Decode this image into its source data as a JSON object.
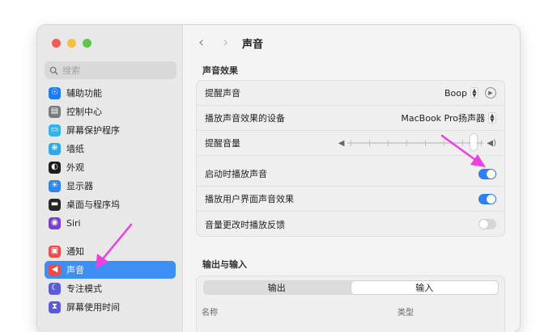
{
  "window": {
    "title": "声音",
    "traffic_lights": {
      "close": "#ee5e57",
      "minimize": "#f5bf41",
      "zoom": "#5ec64d"
    }
  },
  "sidebar": {
    "search": {
      "placeholder": "搜索"
    },
    "items": [
      {
        "label": "辅助功能",
        "icon": "accessibility-icon",
        "color": "#1d7bf0",
        "glyph": "☉"
      },
      {
        "label": "控制中心",
        "icon": "control-center-icon",
        "color": "#7a7a7a",
        "glyph": "▤"
      },
      {
        "label": "屏幕保护程序",
        "icon": "screensaver-icon",
        "color": "#36b3e8",
        "glyph": "▭"
      },
      {
        "label": "墙纸",
        "icon": "wallpaper-icon",
        "color": "#31a7e8",
        "glyph": "❋"
      },
      {
        "label": "外观",
        "icon": "appearance-icon",
        "color": "#1c1c1c",
        "glyph": "◐"
      },
      {
        "label": "显示器",
        "icon": "display-icon",
        "color": "#2f86ee",
        "glyph": "☀"
      },
      {
        "label": "桌面与程序坞",
        "icon": "dock-icon",
        "color": "#262626",
        "glyph": "▬"
      },
      {
        "label": "Siri",
        "icon": "siri-icon",
        "color": "#7b3fd0",
        "glyph": "◉"
      },
      {
        "label": "通知",
        "icon": "notifications-icon",
        "color": "#ec4b4b",
        "glyph": "▣"
      },
      {
        "label": "声音",
        "icon": "sound-icon",
        "color": "#ec4b4b",
        "glyph": "◀"
      },
      {
        "label": "专注模式",
        "icon": "focus-icon",
        "color": "#5b5bd6",
        "glyph": "☾"
      },
      {
        "label": "屏幕使用时间",
        "icon": "screen-time-icon",
        "color": "#5b5bd6",
        "glyph": "⧗"
      }
    ],
    "selected_index": 9,
    "selected_color": "#3d8ff3"
  },
  "main": {
    "back_glyph": "‹",
    "forward_glyph": "›",
    "sound_effects": {
      "heading": "声音效果",
      "alert_sound": {
        "label": "提醒声音",
        "value": "Boop"
      },
      "output_device": {
        "label": "播放声音效果的设备",
        "value": "MacBook Pro扬声器"
      },
      "alert_volume": {
        "label": "提醒音量",
        "level": 0.95
      },
      "startup_sound": {
        "label": "启动时播放声音",
        "on": true
      },
      "ui_sound": {
        "label": "播放用户界面声音效果",
        "on": true
      },
      "volume_feedback": {
        "label": "音量更改时播放反馈",
        "on": false
      }
    },
    "output_input": {
      "heading": "输出与输入",
      "tabs": [
        "输出",
        "输入"
      ],
      "active_tab": 1,
      "columns": [
        "名称",
        "类型"
      ]
    }
  },
  "colors": {
    "toggle_on": "#2f7ff0",
    "toggle_off": "#d6d6d6",
    "annotation_arrow": "#ee3fe0"
  }
}
